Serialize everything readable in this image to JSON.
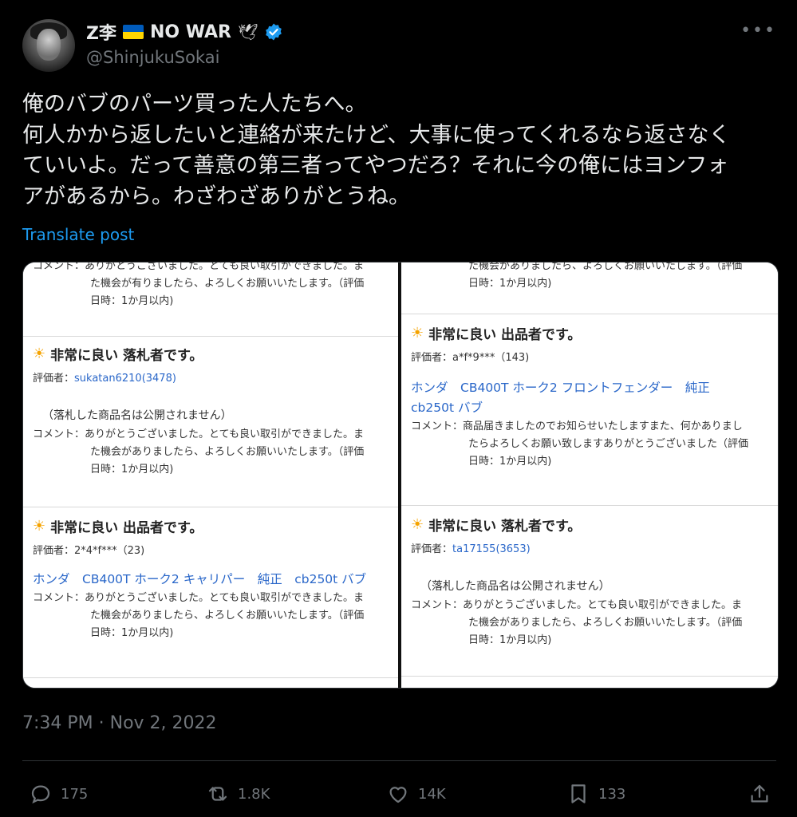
{
  "author": {
    "name": "Z李",
    "flag_label": "NO WAR",
    "dove": "🕊",
    "handle": "@ShinjukuSokai"
  },
  "tweet": {
    "text": "俺のバブのパーツ買った人たちへ。\n何人かから返したいと連絡が来たけど、大事に使ってくれるなら返さなく\nていいよ。だって善意の第三者ってやつだろ？それに今の俺にはヨンフォ\nアがあるから。わざわざありがとうね。",
    "translate_label": "Translate post",
    "timestamp": "7:34 PM · Nov 2, 2022"
  },
  "media": {
    "left": {
      "top_comment": [
        "コメント：ありがとうございました。とても良い取引ができました。ま",
        "た機会が有りましたら、よろしくお願いいたします。（評価",
        "日時：1か月以内)"
      ],
      "r1": {
        "heading": "非常に良い 落札者です。",
        "evaluator_label": "評価者：",
        "evaluator": "sukatan6210",
        "evaluator_count": "(3478)",
        "note": "（落札した商品名は公開されません）",
        "comment": [
          "コメント：ありがとうございました。とても良い取引ができました。ま",
          "た機会がありましたら、よろしくお願いいたします。（評価",
          "日時：1か月以内)"
        ]
      },
      "r2": {
        "heading": "非常に良い 出品者です。",
        "evaluator_line": "評価者：2*4*f***（23)",
        "product": "ホンダ　CB400T ホーク2 キャリパー　純正　cb250t バブ",
        "comment": [
          "コメント：ありがとうございました。とても良い取引ができました。ま",
          "た機会がありましたら、よろしくお願いいたします。（評価",
          "日時：1か月以内)"
        ]
      }
    },
    "right": {
      "top_comment": [
        "た機会がありましたら、よろしくお願いいたします。（評価",
        "日時：1か月以内)"
      ],
      "r1": {
        "heading": "非常に良い 出品者です。",
        "evaluator_line": "評価者：a*f*9***（143)",
        "product_1": "ホンダ　CB400T ホーク2 フロントフェンダー　純正",
        "product_2": "cb250t バブ",
        "comment": [
          "コメント：商品届きましたのでお知らせいたしますまた、何かありまし",
          "たらよろしくお願い致しますありがとうございました（評価",
          "日時：1か月以内)"
        ]
      },
      "r2": {
        "heading": "非常に良い 落札者です。",
        "evaluator_label": "評価者：",
        "evaluator": "ta17155",
        "evaluator_count": "(3653)",
        "note": "（落札した商品名は公開されません）",
        "comment": [
          "コメント：ありがとうございました。とても良い取引ができました。ま",
          "た機会がありましたら、よろしくお願いいたします。（評価",
          "日時：1か月以内)"
        ]
      }
    }
  },
  "actions": {
    "replies": "175",
    "reposts": "1.8K",
    "likes": "14K",
    "bookmarks": "133"
  },
  "colors": {
    "link": "#1d9bf0",
    "muted": "#71767b",
    "verified": "#1d9bf0"
  }
}
